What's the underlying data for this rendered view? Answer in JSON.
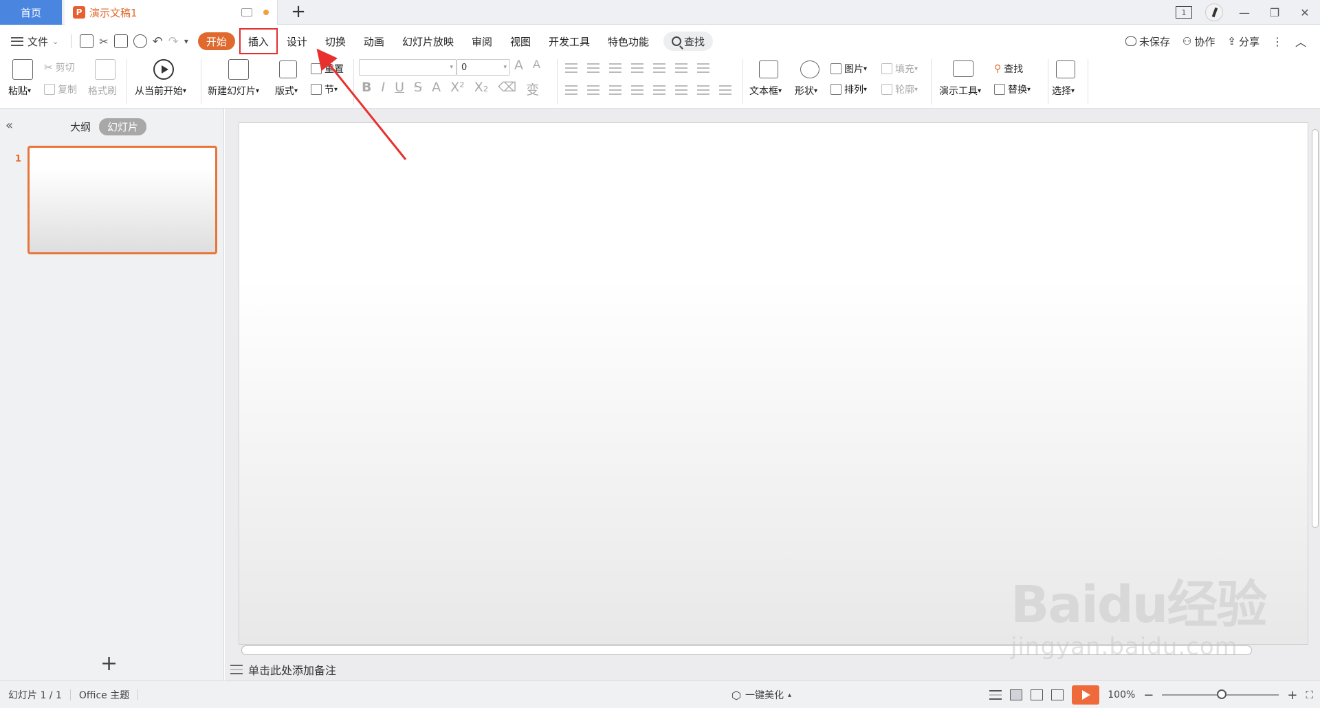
{
  "titlebar": {
    "home_tab": "首页",
    "doc_icon": "P",
    "doc_title": "演示文稿1",
    "new_tab": "+",
    "page_badge": "1"
  },
  "menubar": {
    "file": "文件",
    "start": "开始",
    "insert": "插入",
    "design": "设计",
    "transition": "切换",
    "animation": "动画",
    "slideshow": "幻灯片放映",
    "review": "审阅",
    "view": "视图",
    "devtools": "开发工具",
    "features": "特色功能",
    "search": "查找",
    "unsaved": "未保存",
    "collaborate": "协作",
    "share": "分享"
  },
  "ribbon": {
    "paste": "粘贴",
    "cut": "剪切",
    "copy": "复制",
    "format_painter": "格式刷",
    "from_current": "从当前开始",
    "new_slide": "新建幻灯片",
    "layout": "版式",
    "reset": "重置",
    "section": "节",
    "font_size": "0",
    "textbox": "文本框",
    "shape": "形状",
    "picture": "图片",
    "arrange": "排列",
    "fill": "填充",
    "outline": "轮廓",
    "present_tools": "演示工具",
    "find": "查找",
    "replace": "替换",
    "select": "选择"
  },
  "leftpanel": {
    "outline_tab": "大纲",
    "slides_tab": "幻灯片",
    "slide_number": "1",
    "add": "+"
  },
  "canvas": {
    "notes_placeholder": "单击此处添加备注"
  },
  "statusbar": {
    "slide_info": "幻灯片 1 / 1",
    "theme": "Office 主题",
    "beautify": "一键美化",
    "zoom": "100%"
  },
  "watermark": {
    "main": "Baidu经验",
    "sub": "jingyan.baidu.com"
  },
  "colors": {
    "accent": "#e0692e",
    "home_tab": "#4a86e0",
    "highlight_box": "#e0302e"
  }
}
